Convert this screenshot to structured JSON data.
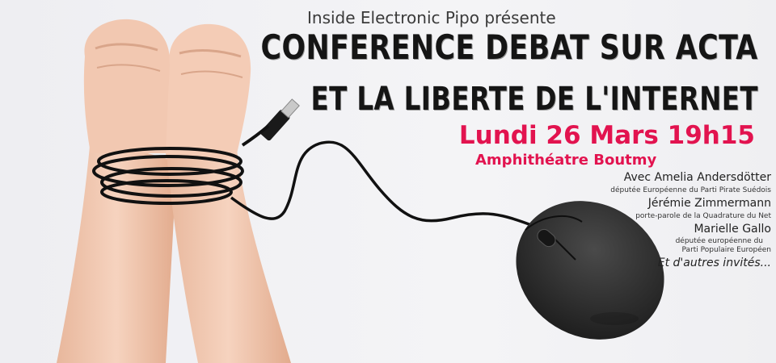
{
  "poster": {
    "presenter": "Inside Electronic Pipo présente",
    "title_line1": "CONFERENCE DEBAT SUR ACTA",
    "title_line2": "ET LA LIBERTE DE L'INTERNET",
    "date": "Lundi 26 Mars 19h15",
    "venue": "Amphithéatre Boutmy"
  },
  "speakers": [
    {
      "name": "Avec Amelia Andersdötter",
      "role": "députée Européenne du Parti Pirate Suédois"
    },
    {
      "name": "Jérémie Zimmermann",
      "role": "porte-parole de la Quadrature du Net"
    },
    {
      "name": "Marielle Gallo",
      "role_line1": "députée européenne du",
      "role_line2": "Parti Populaire Européen"
    }
  ],
  "closing": "Et d'autres invités...",
  "colors": {
    "accent": "#e2134f",
    "title": "#151515",
    "background": "#f1f1f3",
    "mouse": "#2b2b2b"
  },
  "illustration": {
    "subject": "bound-wrists-usb-cable-mouse"
  }
}
